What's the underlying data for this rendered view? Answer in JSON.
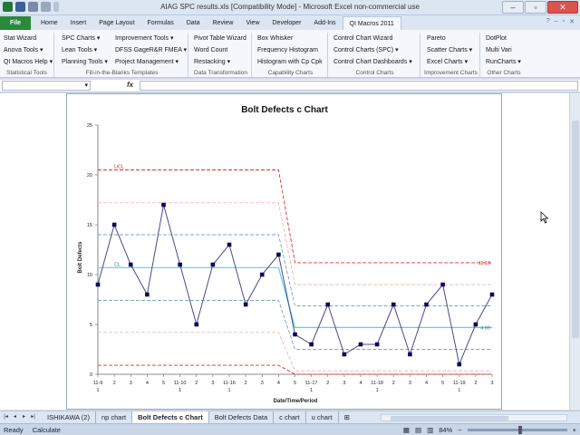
{
  "window": {
    "title": "AIAG SPC results.xls  [Compatibility Mode]  -  Microsoft Excel non-commercial use",
    "minimize": "–",
    "maximize": "▫",
    "close": "✕"
  },
  "tabs": [
    "Home",
    "Insert",
    "Page Layout",
    "Formulas",
    "Data",
    "Review",
    "View",
    "Developer",
    "Add-Ins",
    "QI Macros 2011"
  ],
  "file_tab": "File",
  "active_tab": "QI Macros 2011",
  "ribbon_right_icons": [
    "help-icon",
    "minimize-ribbon-icon",
    "restore-icon",
    "close-workbook-icon"
  ],
  "ribbon": {
    "statistical_tools": {
      "label": "Statistical Tools",
      "items": [
        "Stat Wizard",
        "Anova Tools ▾",
        "QI Macros Help ▾"
      ]
    },
    "fill_in_blanks": {
      "label": "Fill-in-the-Blanks Templates",
      "col1": [
        "SPC Charts ▾",
        "Lean Tools ▾",
        "Planning Tools ▾"
      ],
      "col2": [
        "Improvement Tools ▾",
        "DFSS GageR&R FMEA ▾",
        "Project Management ▾"
      ]
    },
    "data_transformation": {
      "label": "Data Transformation",
      "items": [
        "Pivot Table Wizard",
        "Word Count",
        "Restacking ▾"
      ]
    },
    "capability_charts": {
      "label": "Capability Charts",
      "items": [
        "Box Whisker",
        "Frequency Histogram",
        "Histogram with Cp Cpk"
      ]
    },
    "control_charts": {
      "label": "Control Charts",
      "items": [
        "Control Chart Wizard",
        "Control Charts (SPC) ▾",
        "Control Chart Dashboards ▾"
      ]
    },
    "improvement_charts": {
      "label": "Improvement Charts",
      "items": [
        "Pareto",
        "Scatter Charts ▾",
        "Excel Charts ▾"
      ]
    },
    "other_charts": {
      "label": "Other Charts",
      "items": [
        "DotPlot",
        "Multi Vari",
        "RunCharts ▾"
      ]
    }
  },
  "formula_bar": {
    "fx": "fx",
    "name_value": "",
    "formula_value": ""
  },
  "sheet_tabs": [
    "ISHIKAWA (2)",
    "np chart",
    "Bolt Defects c Chart",
    "Bolt Defects Data",
    "c chart",
    "u chart"
  ],
  "active_sheet": "Bolt Defects c Chart",
  "status": {
    "ready": "Ready",
    "calculate": "Calculate",
    "zoom": "84%",
    "minus": "−",
    "plus": "+"
  },
  "chart_data": {
    "type": "line",
    "title": "Bolt Defects c Chart",
    "xlabel": "Date/Time/Period",
    "ylabel": "Bolt Defects",
    "ylim": [
      0,
      25
    ],
    "yticks": [
      0,
      5,
      10,
      15,
      20,
      25
    ],
    "grid": false,
    "x_labels": [
      {
        "top": "11-9",
        "bottom": "1"
      },
      {
        "top": "2",
        "bottom": ""
      },
      {
        "top": "3",
        "bottom": ""
      },
      {
        "top": "4",
        "bottom": ""
      },
      {
        "top": "5",
        "bottom": ""
      },
      {
        "top": "11-10",
        "bottom": "1"
      },
      {
        "top": "2",
        "bottom": ""
      },
      {
        "top": "3",
        "bottom": ""
      },
      {
        "top": "11-16",
        "bottom": "1"
      },
      {
        "top": "2",
        "bottom": ""
      },
      {
        "top": "3",
        "bottom": ""
      },
      {
        "top": "4",
        "bottom": ""
      },
      {
        "top": "5",
        "bottom": ""
      },
      {
        "top": "11-17",
        "bottom": "1"
      },
      {
        "top": "2",
        "bottom": ""
      },
      {
        "top": "3",
        "bottom": ""
      },
      {
        "top": "4",
        "bottom": ""
      },
      {
        "top": "11-18",
        "bottom": "1"
      },
      {
        "top": "2",
        "bottom": ""
      },
      {
        "top": "3",
        "bottom": ""
      },
      {
        "top": "4",
        "bottom": ""
      },
      {
        "top": "5",
        "bottom": ""
      },
      {
        "top": "11-19",
        "bottom": "1"
      },
      {
        "top": "2",
        "bottom": ""
      },
      {
        "top": "3",
        "bottom": ""
      }
    ],
    "values": [
      9,
      15,
      11,
      8,
      17,
      11,
      5,
      11,
      13,
      7,
      10,
      12,
      4,
      3,
      7,
      2,
      3,
      3,
      7,
      2,
      7,
      9,
      1,
      5,
      8
    ],
    "phases": [
      {
        "start": 0,
        "end": 11,
        "cl": 10.7,
        "ucl": 20.5,
        "lcl": 0.9,
        "sigma2_upper": 17.2,
        "sigma2_lower": 4.2,
        "sigma1_upper": 14.0,
        "sigma1_lower": 7.4
      },
      {
        "start": 12,
        "end": 24,
        "cl": 4.69,
        "ucl": 11.19,
        "lcl": 0,
        "sigma2_upper": 9.0,
        "sigma2_lower": 0.35,
        "sigma1_upper": 6.85,
        "sigma1_lower": 2.5
      }
    ],
    "annotations": {
      "ucl_label": "UCL",
      "cl_label": "CL",
      "ucl2_value": "11.19",
      "cl2_value": "4.69"
    },
    "colors": {
      "data": "#4a4a8a",
      "marker": "#0a0a5a",
      "cl": "#5bd0e8",
      "ucl": "#e03030",
      "sigma2": "#f0a0a0",
      "sigma1": "#4a90a8"
    }
  }
}
